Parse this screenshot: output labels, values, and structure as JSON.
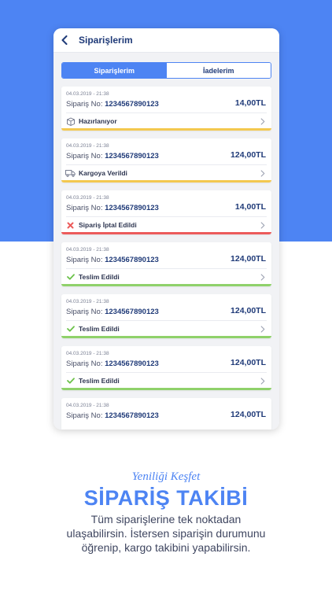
{
  "header": {
    "title": "Siparişlerim"
  },
  "tabs": [
    {
      "label": "Siparişlerim",
      "active": true
    },
    {
      "label": "İadelerim",
      "active": false
    }
  ],
  "orders": [
    {
      "date": "04.03.2019  -  21:38",
      "no_prefix": "Sipariş No: ",
      "no": "1234567890123",
      "price": "14,00TL",
      "status": "Hazırlanıyor",
      "icon": "box-icon",
      "color": "#f3c84f"
    },
    {
      "date": "04.03.2019  -  21:38",
      "no_prefix": "Sipariş No: ",
      "no": "1234567890123",
      "price": "124,00TL",
      "status": "Kargoya Verildi",
      "icon": "truck-icon",
      "color": "#f3c84f"
    },
    {
      "date": "04.03.2019  -  21:38",
      "no_prefix": "Sipariş No: ",
      "no": "1234567890123",
      "price": "14,00TL",
      "status": "Sipariş İptal Edildi",
      "icon": "cross-icon",
      "color": "#ec5b5b"
    },
    {
      "date": "04.03.2019  -  21:38",
      "no_prefix": "Sipariş No: ",
      "no": "1234567890123",
      "price": "124,00TL",
      "status": "Teslim Edildi",
      "icon": "check-icon",
      "color": "#8fd16a"
    },
    {
      "date": "04.03.2019  -  21:38",
      "no_prefix": "Sipariş No: ",
      "no": "1234567890123",
      "price": "124,00TL",
      "status": "Teslim Edildi",
      "icon": "check-icon",
      "color": "#8fd16a"
    },
    {
      "date": "04.03.2019  -  21:38",
      "no_prefix": "Sipariş No: ",
      "no": "1234567890123",
      "price": "124,00TL",
      "status": "Teslim Edildi",
      "icon": "check-icon",
      "color": "#8fd16a"
    },
    {
      "date": "04.03.2019  -  21:38",
      "no_prefix": "Sipariş No: ",
      "no": "1234567890123",
      "price": "124,00TL",
      "status": "",
      "icon": "",
      "color": ""
    }
  ],
  "promo": {
    "tagline": "Yeniliği Keşfet",
    "headline": "SİPARİŞ TAKİBİ",
    "desc_line1": "Tüm siparişlerine tek noktadan",
    "desc_line2": "ulaşabilirsin. İstersen siparişin durumunu",
    "desc_line3": "öğrenip, kargo takibini yapabilirsin."
  },
  "colors": {
    "brand": "#4d84f3",
    "navy": "#1f3a78"
  }
}
